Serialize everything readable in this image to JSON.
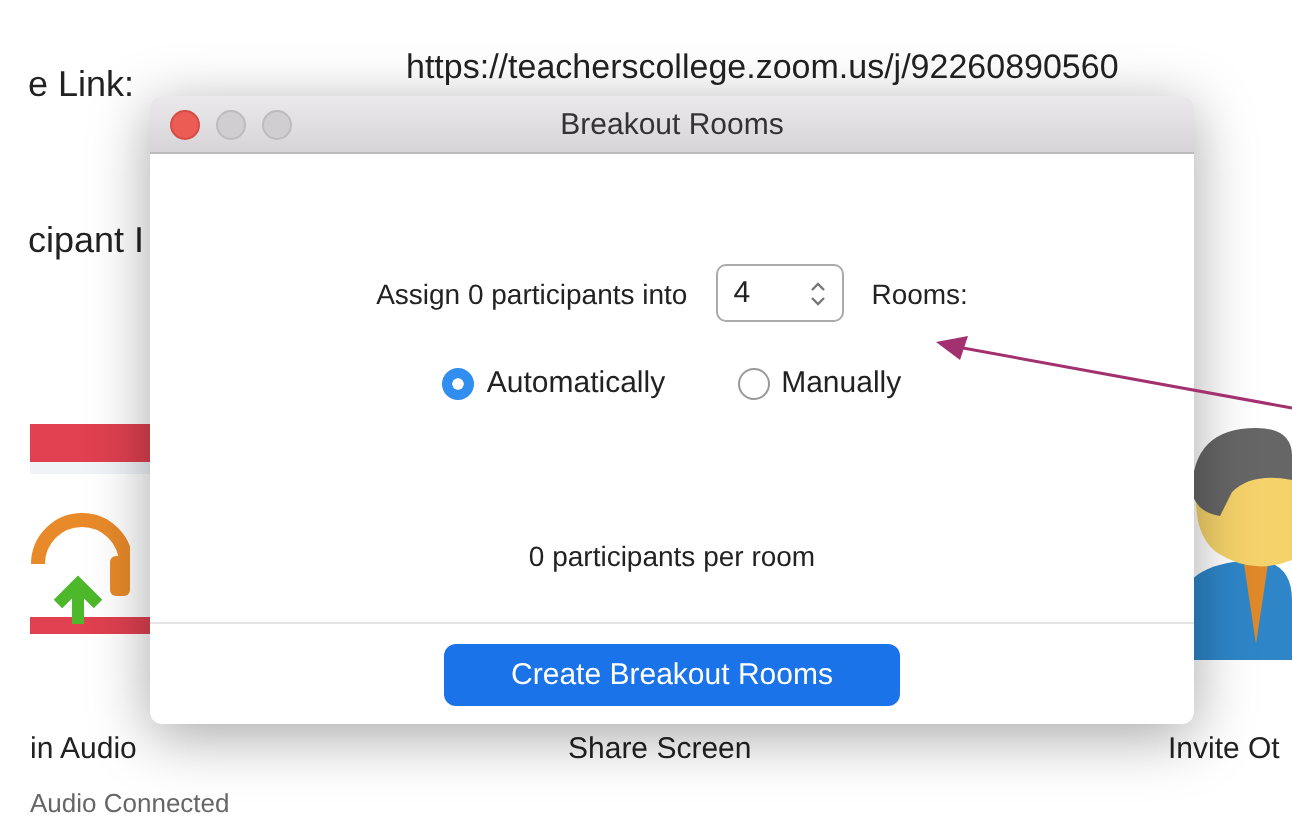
{
  "background": {
    "link_label": "e Link:",
    "link_url": "https://teacherscollege.zoom.us/j/92260890560",
    "participant_label": "cipant I",
    "actions": [
      {
        "label": "in Audio",
        "sublabel": "Audio Connected",
        "kind": "audio"
      },
      {
        "label": "Share Screen",
        "kind": "share"
      },
      {
        "label": "Invite Ot",
        "kind": "invite"
      }
    ]
  },
  "dialog": {
    "title": "Breakout Rooms",
    "assign_prefix": "Assign 0 participants into",
    "rooms_value": "4",
    "rooms_suffix": "Rooms:",
    "options": [
      {
        "label": "Automatically",
        "selected": true
      },
      {
        "label": "Manually",
        "selected": false
      }
    ],
    "per_room": "0 participants per room",
    "button": "Create Breakout Rooms"
  }
}
